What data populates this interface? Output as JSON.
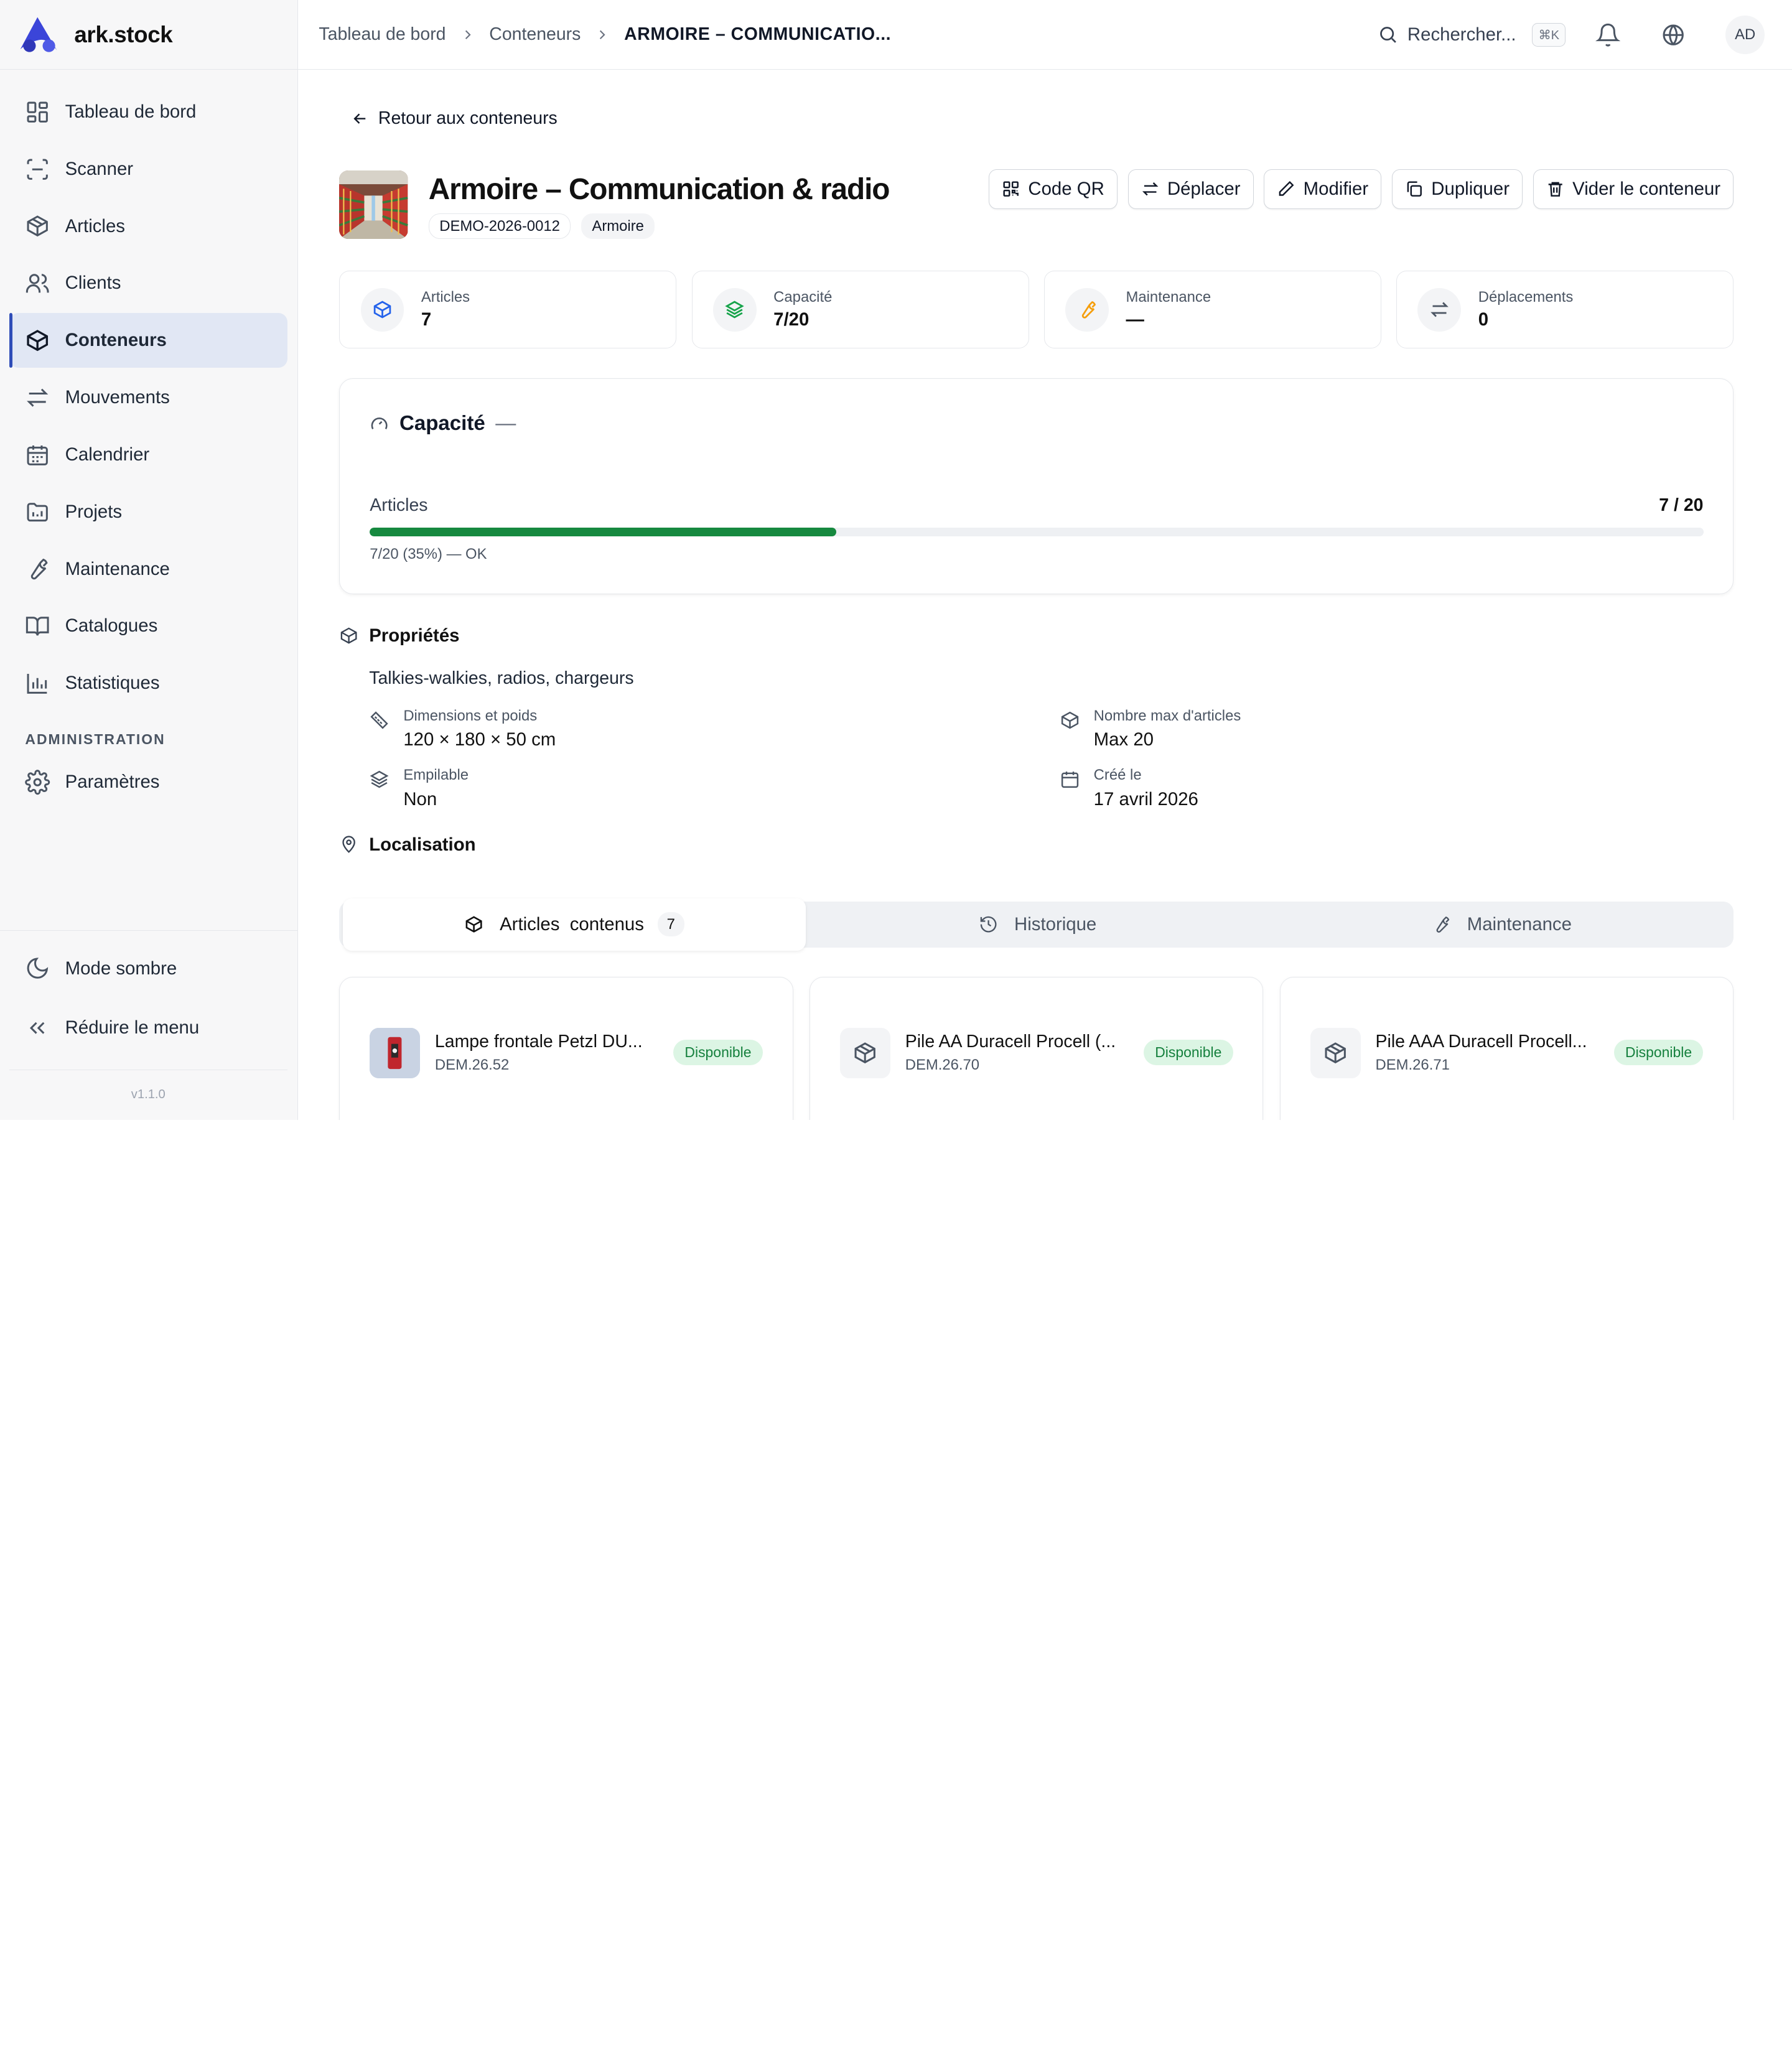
{
  "brand": {
    "name": "ark.stock"
  },
  "sidebar": {
    "items": [
      {
        "label": "Tableau de bord",
        "icon": "dashboard-icon"
      },
      {
        "label": "Scanner",
        "icon": "scan-icon"
      },
      {
        "label": "Articles",
        "icon": "box-icon"
      },
      {
        "label": "Clients",
        "icon": "users-icon"
      },
      {
        "label": "Conteneurs",
        "icon": "container-icon",
        "active": true
      },
      {
        "label": "Mouvements",
        "icon": "arrows-icon"
      },
      {
        "label": "Calendrier",
        "icon": "calendar-icon"
      },
      {
        "label": "Projets",
        "icon": "folder-icon"
      },
      {
        "label": "Maintenance",
        "icon": "wrench-icon"
      },
      {
        "label": "Catalogues",
        "icon": "book-icon"
      },
      {
        "label": "Statistiques",
        "icon": "chart-icon"
      }
    ],
    "admin_section": "ADMINISTRATION",
    "admin_items": [
      {
        "label": "Paramètres",
        "icon": "gear-icon"
      }
    ],
    "dark_mode": "Mode sombre",
    "collapse": "Réduire le menu",
    "version": "v1.1.0"
  },
  "topbar": {
    "breadcrumb": [
      "Tableau de bord",
      "Conteneurs",
      "ARMOIRE – COMMUNICATIO..."
    ],
    "search_label": "Rechercher...",
    "shortcut": "⌘K",
    "avatar": "AD"
  },
  "page": {
    "back_label": "Retour aux conteneurs",
    "title": "Armoire – Communication & radio",
    "code": "DEMO-2026-0012",
    "type": "Armoire",
    "actions": [
      "Code QR",
      "Déplacer",
      "Modifier",
      "Dupliquer",
      "Vider le conteneur"
    ]
  },
  "stats": [
    {
      "label": "Articles",
      "value": "7",
      "icon": "box-icon",
      "color": "#2563eb"
    },
    {
      "label": "Capacité",
      "value": "7/20",
      "icon": "layers-icon",
      "color": "#16a34a"
    },
    {
      "label": "Maintenance",
      "value": "—",
      "icon": "wrench-icon",
      "color": "#f59e0b"
    },
    {
      "label": "Déplacements",
      "value": "0",
      "icon": "arrows-icon",
      "color": "#4b5563"
    }
  ],
  "capacity": {
    "title": "Capacité",
    "dash": "—",
    "label": "Articles",
    "count": "7 / 20",
    "fill_fraction": 0.35,
    "note": "7/20 (35%) — OK",
    "bar_color": "#16893f"
  },
  "properties": {
    "title": "Propriétés",
    "description": "Talkies-walkies, radios, chargeurs",
    "items": [
      {
        "label": "Dimensions et poids",
        "value": "120 × 180 × 50 cm",
        "icon": "ruler-icon"
      },
      {
        "label": "Nombre max d'articles",
        "value": "Max 20",
        "icon": "box-icon"
      },
      {
        "label": "Empilable",
        "value": "Non",
        "icon": "layers-icon"
      },
      {
        "label": "Créé le",
        "value": "17 avril 2026",
        "icon": "calendar-icon"
      }
    ]
  },
  "location": {
    "title": "Localisation"
  },
  "tabs": [
    {
      "label": "Articles  contenus",
      "count": "7",
      "active": true
    },
    {
      "label": "Historique"
    },
    {
      "label": "Maintenance"
    }
  ],
  "items": [
    {
      "name": "Lampe frontale Petzl DU...",
      "ref": "DEM.26.52",
      "status": "Disponible"
    },
    {
      "name": "Pile AA Duracell Procell (...",
      "ref": "DEM.26.70",
      "status": "Disponible"
    },
    {
      "name": "Pile AAA Duracell Procell...",
      "ref": "DEM.26.71",
      "status": "Disponible"
    }
  ]
}
